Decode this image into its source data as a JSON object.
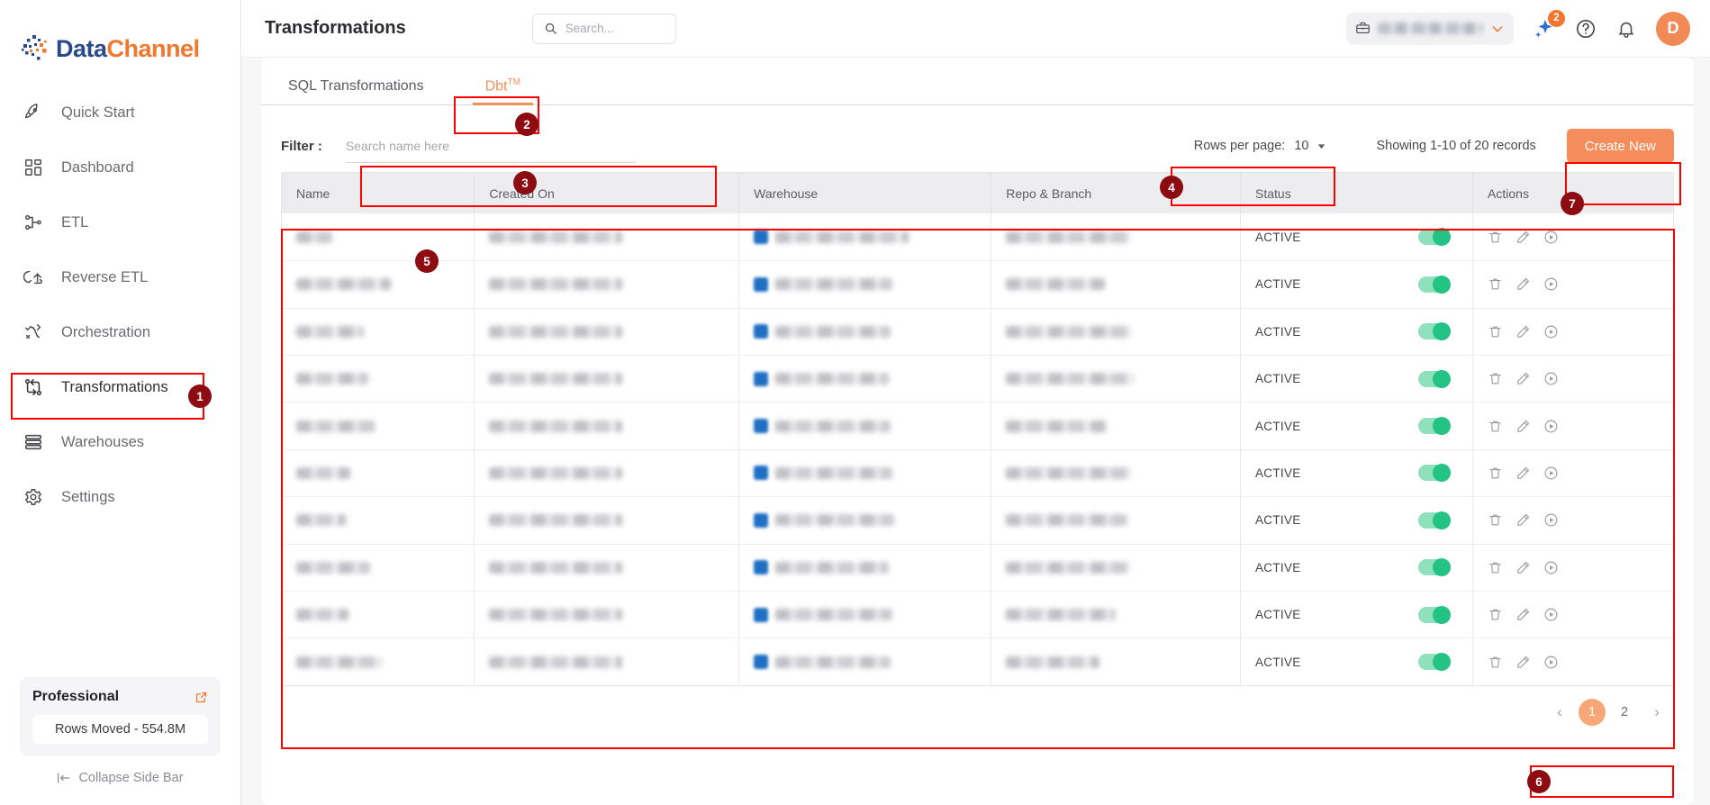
{
  "brand": {
    "name_part1": "Data",
    "name_part2": "Channel"
  },
  "sidebar": {
    "items": [
      {
        "label": "Quick Start",
        "icon": "rocket-icon"
      },
      {
        "label": "Dashboard",
        "icon": "grid-icon"
      },
      {
        "label": "ETL",
        "icon": "etl-icon"
      },
      {
        "label": "Reverse ETL",
        "icon": "reverse-etl-icon"
      },
      {
        "label": "Orchestration",
        "icon": "orchestration-icon"
      },
      {
        "label": "Transformations",
        "icon": "transformations-icon"
      },
      {
        "label": "Warehouses",
        "icon": "warehouses-icon"
      },
      {
        "label": "Settings",
        "icon": "gear-icon"
      }
    ],
    "plan": {
      "title": "Professional",
      "external_icon": "external-link-icon",
      "rows_moved": "Rows Moved - 554.8M"
    },
    "collapse_label": "Collapse Side Bar"
  },
  "header": {
    "title": "Transformations",
    "search_placeholder": "Search...",
    "org_value": "",
    "ai_badge": "2",
    "help_icon": "help-circle-icon",
    "notification_icon": "bell-icon",
    "avatar_initial": "D"
  },
  "tabs": [
    {
      "label": "SQL Transformations",
      "active": false
    },
    {
      "label": "Dbt",
      "superscript": "TM",
      "active": true
    }
  ],
  "toolbar": {
    "filter_label": "Filter :",
    "filter_placeholder": "Search name here",
    "filter_value": "",
    "rows_per_page_label": "Rows per page:",
    "rows_per_page_value": "10",
    "showing_text": "Showing 1-10 of 20 records",
    "create_label": "Create New"
  },
  "table": {
    "columns": [
      "Name",
      "Created On",
      "Warehouse",
      "Repo & Branch",
      "Status",
      "Actions"
    ],
    "rows": [
      {
        "name": "",
        "created_on": "",
        "warehouse": "",
        "repo_branch": "",
        "status": "ACTIVE",
        "enabled": true
      },
      {
        "name": "",
        "created_on": "",
        "warehouse": "",
        "repo_branch": "",
        "status": "ACTIVE",
        "enabled": true
      },
      {
        "name": "",
        "created_on": "",
        "warehouse": "",
        "repo_branch": "",
        "status": "ACTIVE",
        "enabled": true
      },
      {
        "name": "",
        "created_on": "",
        "warehouse": "",
        "repo_branch": "",
        "status": "ACTIVE",
        "enabled": true
      },
      {
        "name": "",
        "created_on": "",
        "warehouse": "",
        "repo_branch": "",
        "status": "ACTIVE",
        "enabled": true
      },
      {
        "name": "",
        "created_on": "",
        "warehouse": "",
        "repo_branch": "",
        "status": "ACTIVE",
        "enabled": true
      },
      {
        "name": "",
        "created_on": "",
        "warehouse": "",
        "repo_branch": "",
        "status": "ACTIVE",
        "enabled": true
      },
      {
        "name": "",
        "created_on": "",
        "warehouse": "",
        "repo_branch": "",
        "status": "ACTIVE",
        "enabled": true
      },
      {
        "name": "",
        "created_on": "",
        "warehouse": "",
        "repo_branch": "",
        "status": "ACTIVE",
        "enabled": true
      },
      {
        "name": "",
        "created_on": "",
        "warehouse": "",
        "repo_branch": "",
        "status": "ACTIVE",
        "enabled": true
      }
    ],
    "action_icons": [
      "delete-icon",
      "edit-icon",
      "run-icon"
    ]
  },
  "pagination": {
    "prev": "‹",
    "pages": [
      "1",
      "2"
    ],
    "current": "1",
    "next": "›"
  },
  "annotations": [
    {
      "num": "1"
    },
    {
      "num": "2"
    },
    {
      "num": "3"
    },
    {
      "num": "4"
    },
    {
      "num": "5"
    },
    {
      "num": "6"
    },
    {
      "num": "7"
    }
  ],
  "colors": {
    "accent_orange": "#f2762e",
    "brand_blue": "#2b4a8b",
    "status_green": "#23c483",
    "annotation_red": "#ff0000",
    "annotation_badge": "#8c0c12"
  }
}
